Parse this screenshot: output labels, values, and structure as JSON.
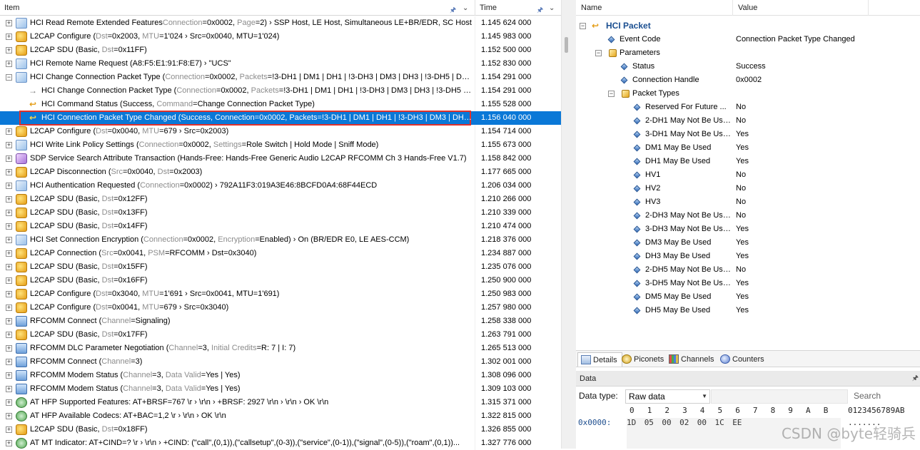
{
  "list": {
    "columns": {
      "item": "Item",
      "time": "Time"
    },
    "rows": [
      {
        "icon": "hci",
        "main": "HCI Read Remote Extended Features",
        "paren": "(",
        "p1k": "Connection",
        "p1v": "=0x0002, ",
        "p2k": "Page",
        "p2v": "=2) ",
        "rest": "› SSP Host, LE Host, Simultaneous LE+BR/EDR, SC Host",
        "time": "1.145 624 000"
      },
      {
        "icon": "l2",
        "main": "L2CAP Configure (",
        "p1k": "Dst",
        "p1v": "=0x2003, ",
        "p2k": "MTU",
        "p2v": "=1'024 › ",
        "rest": "Src=0x0040, MTU=1'024)",
        "time": "1.145 983 000"
      },
      {
        "icon": "l2",
        "main": "L2CAP SDU (Basic, ",
        "p1k": "Dst",
        "p1v": "=0x11FF)",
        "time": "1.152 500 000"
      },
      {
        "icon": "hci",
        "main": "HCI Remote Name Request (A8:F5:E1:91:F8:E7) › \"UCS\"",
        "time": "1.152 830 000"
      },
      {
        "icon": "hci",
        "main": "HCI Change Connection Packet Type (",
        "p1k": "Connection",
        "p1v": "=0x0002, ",
        "p2k": "Packets",
        "p2v": "=!3-DH1 | DM1 | DH1 | !3-DH3 | DM3 | DH3 | !3-DH5 | DM...",
        "time": "1.154 291 000",
        "minus": true
      },
      {
        "icon": "arrow",
        "indent": 1,
        "main": "HCI Change Connection Packet Type (",
        "p1k": "Connection",
        "p1v": "=0x0002, ",
        "p2k": "Packets",
        "p2v": "=!3-DH1 | DM1 | DH1 | !3-DH3 | DM3 | DH3 | !3-DH5 | ...",
        "time": "1.154 291 000"
      },
      {
        "icon": "evt",
        "indent": 1,
        "main": "HCI Command Status (Success, ",
        "p1k": "Command",
        "p1v": "=Change Connection Packet Type)",
        "time": "1.155 528 000"
      },
      {
        "icon": "evt",
        "indent": 1,
        "main": "HCI Connection Packet Type Changed (Success, Connection=0x0002, Packets=!3-DH1 | DM1 | DH1 | !3-DH3 | DM3 | DH3 |...",
        "time": "1.156 040 000",
        "selected": true
      },
      {
        "icon": "l2",
        "main": "L2CAP Configure (",
        "p1k": "Dst",
        "p1v": "=0x0040, ",
        "p2k": "MTU",
        "p2v": "=679 › ",
        "rest": "Src=0x2003)",
        "time": "1.154 714 000"
      },
      {
        "icon": "hci",
        "main": "HCI Write Link Policy Settings (",
        "p1k": "Connection",
        "p1v": "=0x0002, ",
        "p2k": "Settings",
        "p2v": "=Role Switch | Hold Mode | Sniff Mode)",
        "time": "1.155 673 000"
      },
      {
        "icon": "sdp",
        "main": "SDP Service Search Attribute Transaction (Hands-Free: Hands-Free Generic Audio L2CAP RFCOMM Ch 3 Hands-Free V1.7)",
        "time": "1.158 842 000"
      },
      {
        "icon": "l2",
        "main": "L2CAP Disconnection (",
        "p1k": "Src",
        "p1v": "=0x0040, ",
        "p2k": "Dst",
        "p2v": "=0x2003)",
        "time": "1.177 665 000"
      },
      {
        "icon": "hci",
        "main": "HCI Authentication Requested (",
        "p1k": "Connection",
        "p1v": "=0x0002) › 792A11F3:019A3E46:8BCFD0A4:68F44ECD",
        "time": "1.206 034 000"
      },
      {
        "icon": "l2",
        "main": "L2CAP SDU (Basic, ",
        "p1k": "Dst",
        "p1v": "=0x12FF)",
        "time": "1.210 266 000"
      },
      {
        "icon": "l2",
        "main": "L2CAP SDU (Basic, ",
        "p1k": "Dst",
        "p1v": "=0x13FF)",
        "time": "1.210 339 000"
      },
      {
        "icon": "l2",
        "main": "L2CAP SDU (Basic, ",
        "p1k": "Dst",
        "p1v": "=0x14FF)",
        "time": "1.210 474 000"
      },
      {
        "icon": "hci",
        "main": "HCI Set Connection Encryption (",
        "p1k": "Connection",
        "p1v": "=0x0002, ",
        "p2k": "Encryption",
        "p2v": "=Enabled) › On (BR/EDR E0, LE AES-CCM)",
        "time": "1.218 376 000"
      },
      {
        "icon": "l2",
        "main": "L2CAP Connection (",
        "p1k": "Src",
        "p1v": "=0x0041, ",
        "p2k": "PSM",
        "p2v": "=RFCOMM › ",
        "rest": "Dst=0x3040)",
        "time": "1.234 887 000"
      },
      {
        "icon": "l2",
        "main": "L2CAP SDU (Basic, ",
        "p1k": "Dst",
        "p1v": "=0x15FF)",
        "time": "1.235 076 000"
      },
      {
        "icon": "l2",
        "main": "L2CAP SDU (Basic, ",
        "p1k": "Dst",
        "p1v": "=0x16FF)",
        "time": "1.250 900 000"
      },
      {
        "icon": "l2",
        "main": "L2CAP Configure (",
        "p1k": "Dst",
        "p1v": "=0x3040, ",
        "p2k": "MTU",
        "p2v": "=1'691 › ",
        "rest": "Src=0x0041, MTU=1'691)",
        "time": "1.250 983 000"
      },
      {
        "icon": "l2",
        "main": "L2CAP Configure (",
        "p1k": "Dst",
        "p1v": "=0x0041, ",
        "p2k": "MTU",
        "p2v": "=679 › ",
        "rest": "Src=0x3040)",
        "time": "1.257 980 000"
      },
      {
        "icon": "rf",
        "main": "RFCOMM Connect (",
        "p1k": "Channel",
        "p1v": "=Signaling)",
        "time": "1.258 338 000"
      },
      {
        "icon": "l2",
        "main": "L2CAP SDU (Basic, ",
        "p1k": "Dst",
        "p1v": "=0x17FF)",
        "time": "1.263 791 000"
      },
      {
        "icon": "rf",
        "main": "RFCOMM DLC Parameter Negotiation (",
        "p1k": "Channel",
        "p1v": "=3, ",
        "p2k": "Initial Credits",
        "p2v": "=R: 7 | I: 7)",
        "time": "1.265 513 000"
      },
      {
        "icon": "rf",
        "main": "RFCOMM Connect (",
        "p1k": "Channel",
        "p1v": "=3)",
        "time": "1.302 001 000"
      },
      {
        "icon": "rf",
        "main": "RFCOMM Modem Status (",
        "p1k": "Channel",
        "p1v": "=3, ",
        "p2k": "Data Valid",
        "p2v": "=Yes | Yes)",
        "time": "1.308 096 000"
      },
      {
        "icon": "rf",
        "main": "RFCOMM Modem Status (",
        "p1k": "Channel",
        "p1v": "=3, ",
        "p2k": "Data Valid",
        "p2v": "=Yes | Yes)",
        "time": "1.309 103 000"
      },
      {
        "icon": "at",
        "main": "AT HFP Supported Features: AT+BRSF=767 \\r › \\r\\n › +BRSF: 2927 \\r\\n › \\r\\n › OK \\r\\n",
        "time": "1.315 371 000"
      },
      {
        "icon": "at",
        "main": "AT HFP Available Codecs: AT+BAC=1,2 \\r › \\r\\n › OK \\r\\n",
        "time": "1.322 815 000"
      },
      {
        "icon": "l2",
        "main": "L2CAP SDU (Basic, ",
        "p1k": "Dst",
        "p1v": "=0x18FF)",
        "time": "1.326 855 000"
      },
      {
        "icon": "at",
        "main": "AT MT Indicator: AT+CIND=? \\r › \\r\\n › +CIND: (\"call\",(0,1)),(\"callsetup\",(0-3)),(\"service\",(0-1)),(\"signal\",(0-5)),(\"roam\",(0,1))...",
        "time": "1.327 776 000"
      }
    ]
  },
  "details": {
    "columns": {
      "name": "Name",
      "value": "Value"
    },
    "root": "HCI Packet",
    "rows": [
      {
        "level": 1,
        "kind": "dia",
        "name": "Event Code",
        "value": "Connection Packet Type Changed"
      },
      {
        "level": 1,
        "kind": "grp",
        "name": "Parameters",
        "value": "",
        "minus": true
      },
      {
        "level": 2,
        "kind": "dia",
        "name": "Status",
        "value": "Success"
      },
      {
        "level": 2,
        "kind": "dia",
        "name": "Connection Handle",
        "value": "0x0002"
      },
      {
        "level": 2,
        "kind": "grp",
        "name": "Packet Types",
        "value": "",
        "minus": true
      },
      {
        "level": 3,
        "kind": "dia",
        "name": "Reserved For Future ...",
        "value": "No"
      },
      {
        "level": 3,
        "kind": "dia",
        "name": "2-DH1 May Not Be Used",
        "value": "No"
      },
      {
        "level": 3,
        "kind": "dia",
        "name": "3-DH1 May Not Be Used",
        "value": "Yes"
      },
      {
        "level": 3,
        "kind": "dia",
        "name": "DM1 May Be Used",
        "value": "Yes"
      },
      {
        "level": 3,
        "kind": "dia",
        "name": "DH1 May Be Used",
        "value": "Yes"
      },
      {
        "level": 3,
        "kind": "dia",
        "name": "HV1",
        "value": "No"
      },
      {
        "level": 3,
        "kind": "dia",
        "name": "HV2",
        "value": "No"
      },
      {
        "level": 3,
        "kind": "dia",
        "name": "HV3",
        "value": "No"
      },
      {
        "level": 3,
        "kind": "dia",
        "name": "2-DH3 May Not Be Used",
        "value": "No"
      },
      {
        "level": 3,
        "kind": "dia",
        "name": "3-DH3 May Not Be Used",
        "value": "Yes"
      },
      {
        "level": 3,
        "kind": "dia",
        "name": "DM3 May Be Used",
        "value": "Yes"
      },
      {
        "level": 3,
        "kind": "dia",
        "name": "DH3 May Be Used",
        "value": "Yes"
      },
      {
        "level": 3,
        "kind": "dia",
        "name": "2-DH5 May Not Be Used",
        "value": "No"
      },
      {
        "level": 3,
        "kind": "dia",
        "name": "3-DH5 May Not Be Used",
        "value": "Yes"
      },
      {
        "level": 3,
        "kind": "dia",
        "name": "DM5 May Be Used",
        "value": "Yes"
      },
      {
        "level": 3,
        "kind": "dia",
        "name": "DH5 May Be Used",
        "value": "Yes"
      }
    ]
  },
  "tabs": [
    {
      "label": "Details",
      "icon": "det",
      "active": true
    },
    {
      "label": "Piconets",
      "icon": "pico"
    },
    {
      "label": "Channels",
      "icon": "chan"
    },
    {
      "label": "Counters",
      "icon": "cnt"
    }
  ],
  "data_panel": {
    "title": "Data",
    "type_label": "Data type:",
    "type_value": "Raw data",
    "search_label": "Search",
    "hex_columns": [
      "0",
      "1",
      "2",
      "3",
      "4",
      "5",
      "6",
      "7",
      "8",
      "9",
      "A",
      "B"
    ],
    "ascii_header": "0123456789AB",
    "offset": "0x0000:",
    "bytes": [
      "1D",
      "05",
      "00",
      "02",
      "00",
      "1C",
      "EE"
    ],
    "ascii": "......."
  },
  "watermark": "CSDN @byte轻骑兵"
}
